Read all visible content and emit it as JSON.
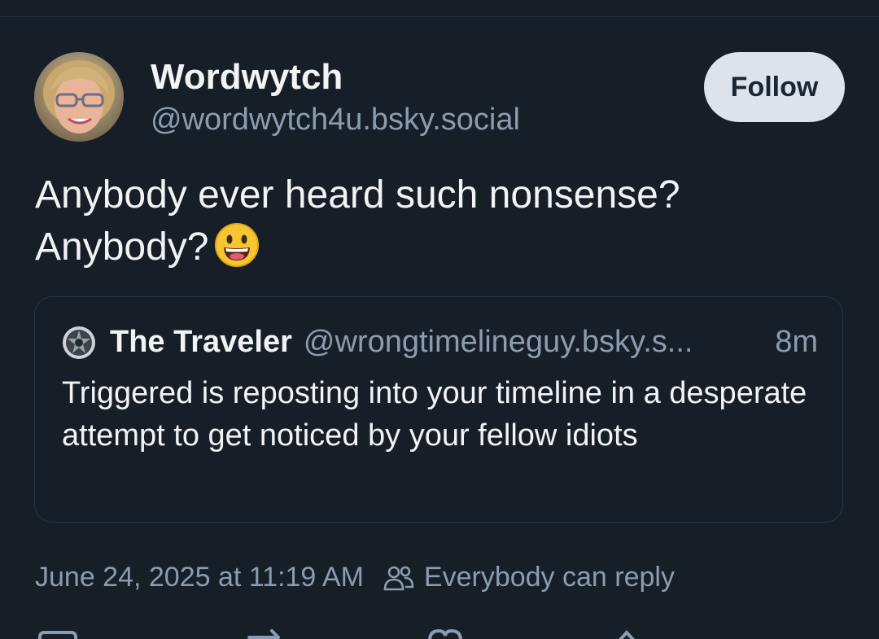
{
  "post": {
    "author": {
      "display_name": "Wordwytch",
      "handle": "@wordwytch4u.bsky.social"
    },
    "follow_label": "Follow",
    "text_line1": "Anybody ever heard such nonsense?",
    "text_line2": "Anybody?",
    "emoji": "😀",
    "quote": {
      "display_name": "The Traveler",
      "handle": "@wrongtimelineguy.bsky.s...",
      "time": "8m",
      "text": "Triggered is reposting into your timeline in a desperate attempt to get noticed by your fellow idiots"
    },
    "timestamp": "June 24, 2025 at 11:19 AM",
    "reply_setting": "Everybody can reply"
  },
  "icons": {
    "reply_setting": "people-icon",
    "actions": [
      "reply-icon",
      "repost-icon",
      "like-icon",
      "more-icon"
    ]
  },
  "colors": {
    "background": "#161e27",
    "text_primary": "#f1f3f5",
    "text_secondary": "#8c9cb0",
    "follow_button_bg": "#dce3ea",
    "card_border": "#2b3746"
  }
}
